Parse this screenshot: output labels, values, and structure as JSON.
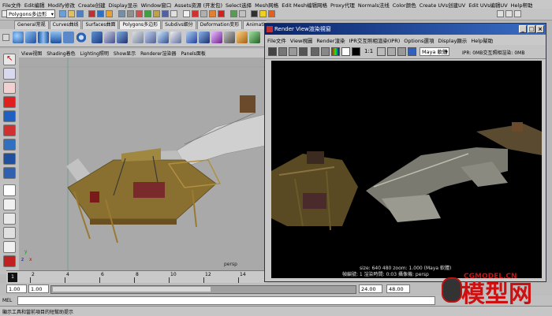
{
  "main_menu": [
    "File文件",
    "Edit编辑",
    "Modify修改",
    "Create创建",
    "Display显示",
    "Window窗口",
    "Assets资源 (开发包)",
    "Select选择",
    "Mesh网格",
    "Edit Mesh编辑网格",
    "Proxy代理",
    "Normals法线",
    "Color颜色",
    "Create UVs创建UV",
    "Edit UVs编辑UV",
    "Help帮助"
  ],
  "mode_selector": {
    "value": "Polygons多边形"
  },
  "shelf_tabs": [
    "General常规",
    "Curves曲线",
    "Surfaces曲面",
    "Polygons多边形",
    "Subdivs细分",
    "Deformation变形",
    "Animation动画",
    "Dynamics"
  ],
  "active_shelf_tab": "Polygons多边形",
  "panel_menu": [
    "View视图",
    "Shading着色",
    "Lighting照明",
    "Show显示",
    "Renderer渲染器",
    "Panels面板"
  ],
  "viewport": {
    "camera_label": "persp",
    "axis_labels": [
      "x",
      "y",
      "z"
    ]
  },
  "time_slider": {
    "ticks": [
      "2",
      "4",
      "6",
      "8",
      "10",
      "12",
      "14"
    ],
    "current_frame": "1"
  },
  "range_slider": {
    "start": "1.00",
    "inner_start": "1.00",
    "inner_end": "24.00",
    "end": "48.00"
  },
  "command_line": {
    "label": "MEL"
  },
  "help_line": {
    "text": "顯示工具和當前項目的短幫助提示"
  },
  "render_view": {
    "title": "Render View渲染視窗",
    "menu": [
      "File文件",
      "View視圖",
      "Render渲染",
      "IPR交互照相渲染(IPR)",
      "Options選項",
      "Display顯示",
      "Help幫助"
    ],
    "ratio_label": "1:1",
    "camera_select": "Maya 軟體",
    "ipr_status": "IPR: 0MB交互照相渲染: 0MB",
    "info_line1": "size:  640  480 zoom: 1.000      (Maya 軟體)",
    "info_line2": "幀編號: 1        渲染時間: 0:03         攝像機: persp"
  },
  "watermark": {
    "url": "CGMODEL.CN",
    "text": "模型网"
  },
  "colors": {
    "title_bar": "#0a246a",
    "viewport_bg": "#a9a9a9",
    "render_bg": "#000000",
    "watermark_red": "#d01010"
  }
}
